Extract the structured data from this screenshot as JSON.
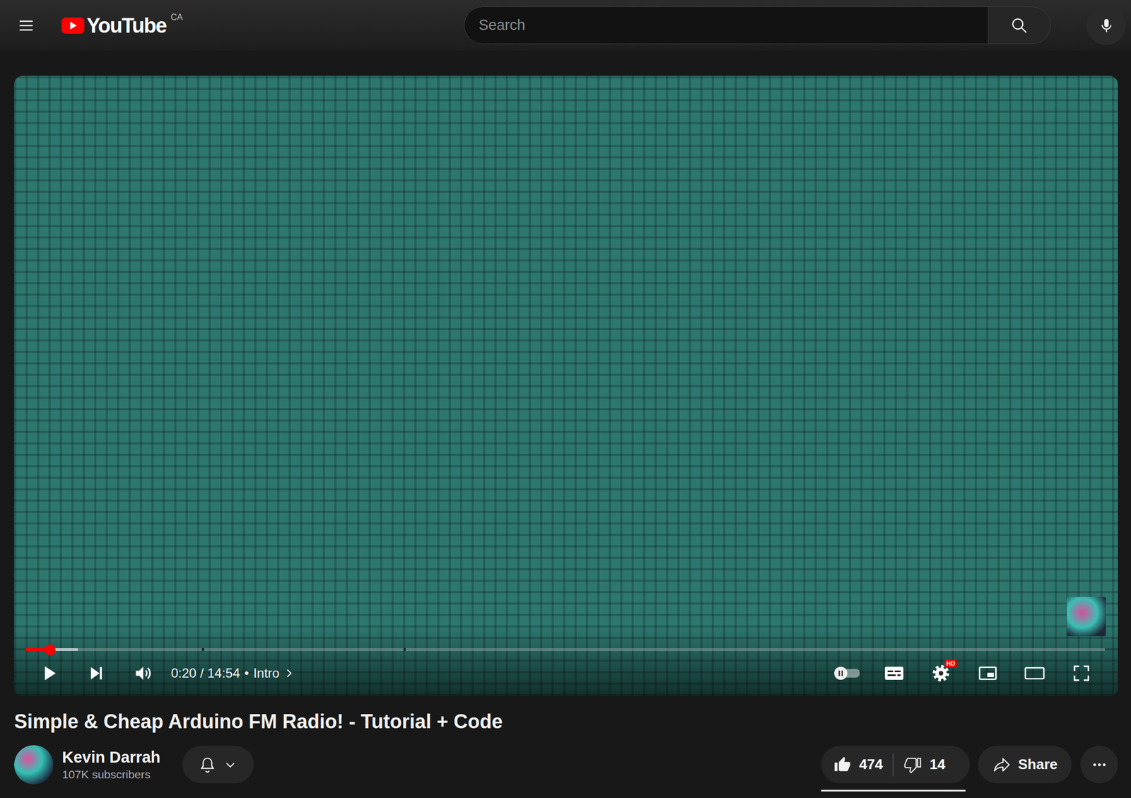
{
  "header": {
    "logo": "YouTube",
    "country": "CA",
    "search": {
      "placeholder": "Search"
    }
  },
  "player": {
    "playing": false,
    "progress": {
      "level": 0.022,
      "buffered": 0.048
    },
    "chapter_marks": [
      0.163,
      0.35
    ],
    "time": "0:20 / 14:54",
    "separator": "•",
    "chapter": "Intro",
    "autoplay": false,
    "subtitles": false,
    "hd_badge": "HD"
  },
  "video": {
    "title": "Simple & Cheap Arduino FM Radio! - Tutorial + Code"
  },
  "channel": {
    "name": "Kevin Darrah",
    "subscribers": "107K subscribers"
  },
  "actions": {
    "likes": "474",
    "liked": true,
    "dislikes": "14",
    "disliked": false,
    "ratio_level": 0.97,
    "share": "Share"
  }
}
